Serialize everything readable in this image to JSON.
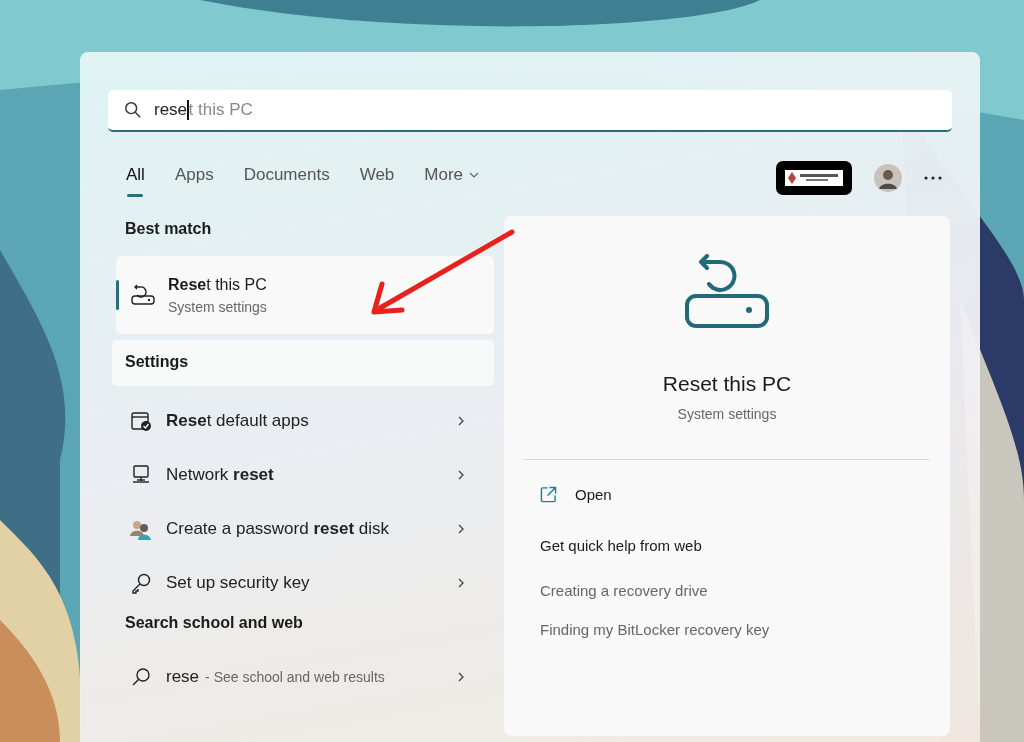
{
  "search": {
    "value": "rese",
    "suggestion": "t this PC"
  },
  "tabs": [
    {
      "label": "All",
      "selected": true,
      "kind": "tab"
    },
    {
      "label": "Apps",
      "selected": false,
      "kind": "tab"
    },
    {
      "label": "Documents",
      "selected": false,
      "kind": "tab"
    },
    {
      "label": "Web",
      "selected": false,
      "kind": "tab"
    },
    {
      "label": "More",
      "selected": false,
      "kind": "dropdown"
    }
  ],
  "best_match": {
    "heading": "Best match",
    "item": {
      "title": "**Rese**t this PC",
      "subtitle": "System settings",
      "selected": true
    }
  },
  "settings": {
    "heading": "Settings",
    "items": [
      {
        "title": "**Rese**t default apps",
        "kind": "apps"
      },
      {
        "title": "Network **reset**",
        "kind": "network"
      },
      {
        "title": "Create a password **reset** disk",
        "kind": "users"
      },
      {
        "title": "Set up security key",
        "kind": "key"
      }
    ]
  },
  "web": {
    "heading": "Search school and web",
    "items": [
      {
        "query": "rese",
        "hint": "- See school and web results"
      }
    ]
  },
  "preview": {
    "title": "Reset this PC",
    "subtitle": "System settings",
    "actions": [
      {
        "label": "Open"
      }
    ],
    "help_heading": "Get quick help from web",
    "links": [
      "Creating a recovery drive",
      "Finding my BitLocker recovery key"
    ]
  }
}
